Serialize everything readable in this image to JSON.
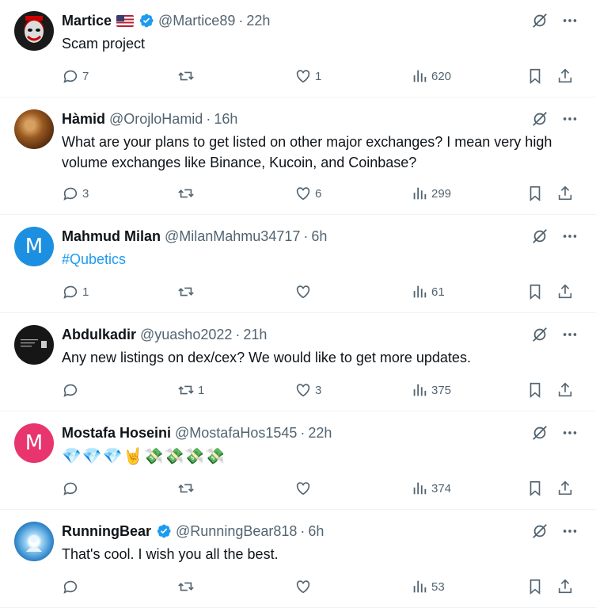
{
  "icons": {
    "grok": "grok-icon",
    "more": "more-icon",
    "reply": "reply-icon",
    "repost": "repost-icon",
    "like": "like-icon",
    "views": "views-icon",
    "bookmark": "bookmark-icon",
    "share": "share-icon",
    "verified": "verified-badge-icon"
  },
  "colors": {
    "accent": "#1d9bf0",
    "muted": "#536471",
    "text": "#0f1419",
    "divider": "#eff3f4"
  },
  "tweets": [
    {
      "name": "Martice",
      "handle": "@Martice89",
      "sep": "·",
      "time": "22h",
      "text": "Scam project",
      "replies": "7",
      "reposts": "",
      "likes": "1",
      "views": "620"
    },
    {
      "name": "Hàmid",
      "handle": "@OrojloHamid",
      "sep": "·",
      "time": "16h",
      "text": "What are your plans to get listed on other major exchanges? I mean very high volume exchanges like Binance, Kucoin, and Coinbase?",
      "replies": "3",
      "reposts": "",
      "likes": "6",
      "views": "299"
    },
    {
      "name": "Mahmud Milan",
      "handle": "@MilanMahmu34717",
      "sep": "·",
      "time": "6h",
      "avatar_letter": "M",
      "text": "#Qubetics",
      "replies": "1",
      "reposts": "",
      "likes": "",
      "views": "61"
    },
    {
      "name": "Abdulkadir",
      "handle": "@yuasho2022",
      "sep": "·",
      "time": "21h",
      "text": "Any new listings on dex/cex?  We would like to get more updates.",
      "replies": "",
      "reposts": "1",
      "likes": "3",
      "views": "375"
    },
    {
      "name": "Mostafa Hoseini",
      "handle": "@MostafaHos1545",
      "sep": "·",
      "time": "22h",
      "avatar_letter": "M",
      "text": "💎💎💎🤘💸💸💸💸",
      "replies": "",
      "reposts": "",
      "likes": "",
      "views": "374"
    },
    {
      "name": "RunningBear",
      "handle": "@RunningBear818",
      "sep": "·",
      "time": "6h",
      "text": "That's cool. I wish you all the best.",
      "replies": "",
      "reposts": "",
      "likes": "",
      "views": "53"
    }
  ]
}
